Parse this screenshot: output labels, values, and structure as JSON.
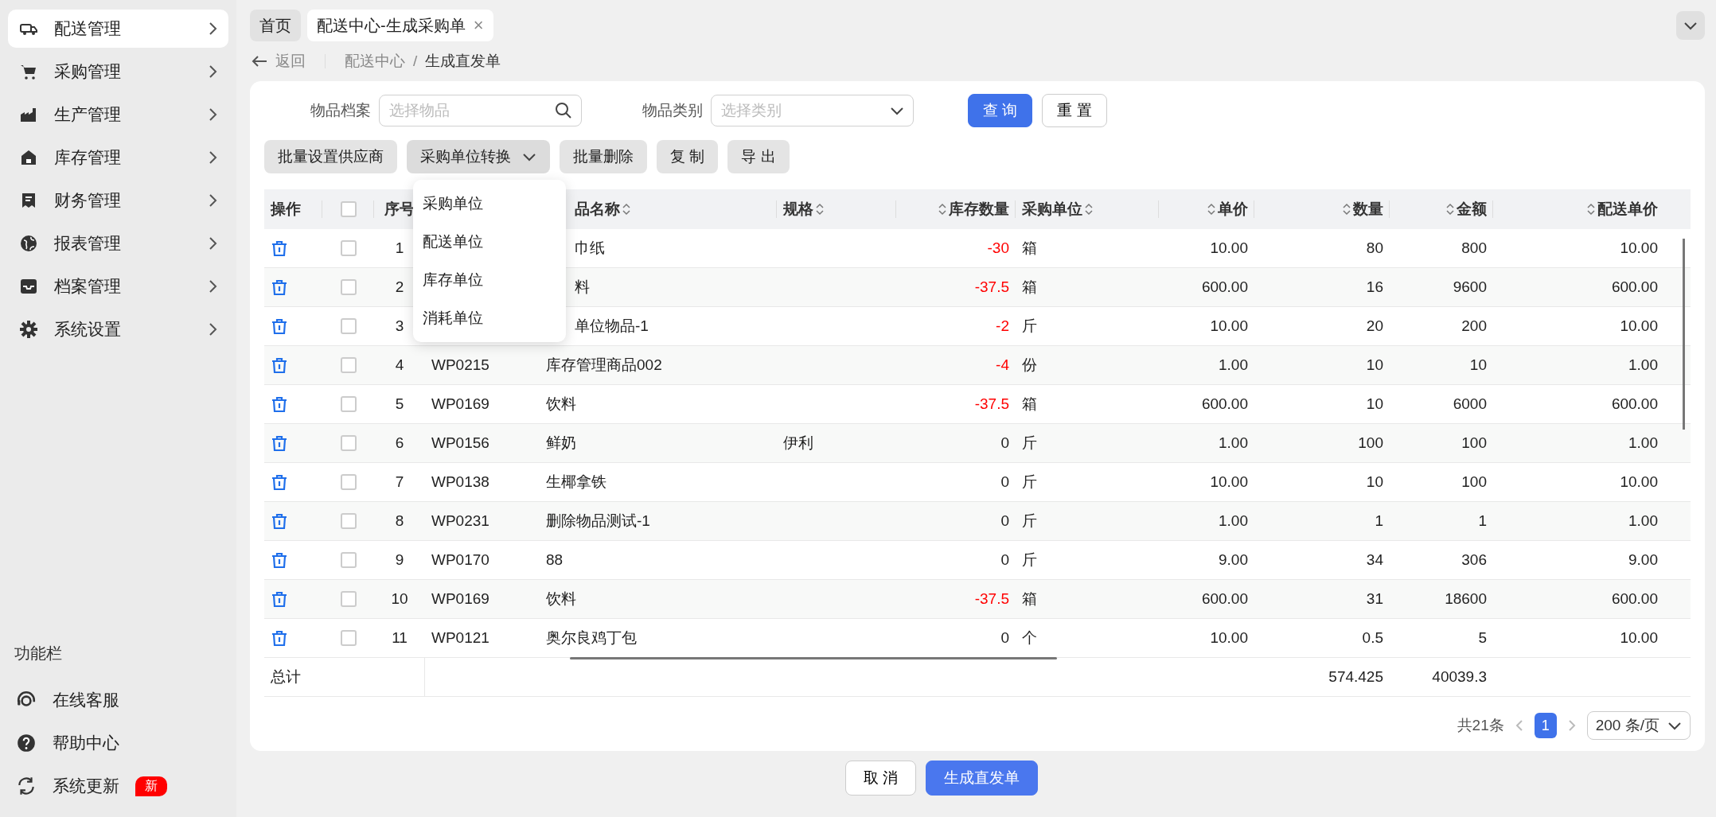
{
  "sidebar": {
    "items": [
      {
        "label": "配送管理",
        "selected": true
      },
      {
        "label": "采购管理",
        "selected": false
      },
      {
        "label": "生产管理",
        "selected": false
      },
      {
        "label": "库存管理",
        "selected": false
      },
      {
        "label": "财务管理",
        "selected": false
      },
      {
        "label": "报表管理",
        "selected": false
      },
      {
        "label": "档案管理",
        "selected": false
      },
      {
        "label": "系统设置",
        "selected": false
      }
    ],
    "footer_title": "功能栏",
    "footer_items": [
      {
        "label": "在线客服"
      },
      {
        "label": "帮助中心"
      },
      {
        "label": "系统更新",
        "badge": "新"
      }
    ]
  },
  "tabs": [
    {
      "label": "首页",
      "selected": false,
      "closable": false
    },
    {
      "label": "配送中心-生成采购单",
      "selected": true,
      "closable": true
    }
  ],
  "tab_close": "×",
  "back": "返回",
  "breadcrumb": [
    {
      "label": "配送中心",
      "current": false
    },
    {
      "label": "生成直发单",
      "current": true
    }
  ],
  "breadcrumb_separator": "/",
  "filters": [
    {
      "label": "物品档案",
      "placeholder": "选择物品",
      "kind": "search"
    },
    {
      "label": "物品类别",
      "placeholder": "选择类别",
      "kind": "select"
    }
  ],
  "filter_buttons": [
    {
      "label": "查 询",
      "primary": true
    },
    {
      "label": "重 置",
      "primary": false
    }
  ],
  "toolbar": [
    {
      "label": "批量设置供应商",
      "kind": "button"
    },
    {
      "label": "采购单位转换",
      "kind": "dropdown",
      "expanded": true,
      "options": [
        "采购单位",
        "配送单位",
        "库存单位",
        "消耗单位"
      ]
    },
    {
      "label": "批量删除",
      "kind": "button"
    },
    {
      "label": "复 制",
      "kind": "button"
    },
    {
      "label": "导 出",
      "kind": "button"
    }
  ],
  "table": {
    "columns": [
      {
        "label": "操作",
        "sortable": false
      },
      {
        "kind": "checkbox",
        "checked": false
      },
      {
        "label": "序号",
        "sortable": false
      },
      null,
      {
        "label": "品名称",
        "sortable": true
      },
      {
        "label": "规格",
        "sortable": true
      },
      {
        "label": "库存数量",
        "sortable": true
      },
      {
        "label": "采购单位",
        "sortable": true
      },
      {
        "label": "单价",
        "sortable": true
      },
      {
        "label": "数量",
        "sortable": true
      },
      {
        "label": "金额",
        "sortable": true
      },
      {
        "label": "配送单价",
        "sortable": true
      }
    ],
    "rows": [
      {
        "checked": false,
        "no": "1",
        "name": "巾纸",
        "stock": "-30",
        "stock_negative": true,
        "unit": "箱",
        "price": "10.00",
        "qty": "80",
        "amount": "800",
        "dist_price": "10.00"
      },
      {
        "checked": false,
        "no": "2",
        "name": "料",
        "stock": "-37.5",
        "stock_negative": true,
        "unit": "箱",
        "price": "600.00",
        "qty": "16",
        "amount": "9600",
        "dist_price": "600.00"
      },
      {
        "checked": false,
        "no": "3",
        "name": "单位物品-1",
        "stock": "-2",
        "stock_negative": true,
        "unit": "斤",
        "price": "10.00",
        "qty": "20",
        "amount": "200",
        "dist_price": "10.00"
      },
      {
        "checked": false,
        "no": "4",
        "code": "WP0215",
        "name": "库存管理商品002",
        "stock": "-4",
        "stock_negative": true,
        "unit": "份",
        "price": "1.00",
        "qty": "10",
        "amount": "10",
        "dist_price": "1.00"
      },
      {
        "checked": false,
        "no": "5",
        "code": "WP0169",
        "name": "饮料",
        "stock": "-37.5",
        "stock_negative": true,
        "unit": "箱",
        "price": "600.00",
        "qty": "10",
        "amount": "6000",
        "dist_price": "600.00"
      },
      {
        "checked": false,
        "no": "6",
        "code": "WP0156",
        "name": "鲜奶",
        "spec": "伊利",
        "stock": "0",
        "stock_negative": false,
        "unit": "斤",
        "price": "1.00",
        "qty": "100",
        "amount": "100",
        "dist_price": "1.00"
      },
      {
        "checked": false,
        "no": "7",
        "code": "WP0138",
        "name": "生椰拿铁",
        "stock": "0",
        "stock_negative": false,
        "unit": "斤",
        "price": "10.00",
        "qty": "10",
        "amount": "100",
        "dist_price": "10.00"
      },
      {
        "checked": false,
        "no": "8",
        "code": "WP0231",
        "name": "删除物品测试-1",
        "stock": "0",
        "stock_negative": false,
        "unit": "斤",
        "price": "1.00",
        "qty": "1",
        "amount": "1",
        "dist_price": "1.00"
      },
      {
        "checked": false,
        "no": "9",
        "code": "WP0170",
        "name": "88",
        "stock": "0",
        "stock_negative": false,
        "unit": "斤",
        "price": "9.00",
        "qty": "34",
        "amount": "306",
        "dist_price": "9.00"
      },
      {
        "checked": false,
        "no": "10",
        "code": "WP0169",
        "name": "饮料",
        "stock": "-37.5",
        "stock_negative": true,
        "unit": "箱",
        "price": "600.00",
        "qty": "31",
        "amount": "18600",
        "dist_price": "600.00"
      },
      {
        "checked": false,
        "no": "11",
        "code": "WP0121",
        "name": "奥尔良鸡丁包",
        "stock": "0",
        "stock_negative": false,
        "unit": "个",
        "price": "10.00",
        "qty": "0.5",
        "amount": "5",
        "dist_price": "10.00"
      }
    ],
    "total": {
      "label": "总计",
      "qty": "574.425",
      "amount": "40039.3"
    }
  },
  "pagination": {
    "total": "共21条",
    "pages": [
      {
        "label": "1",
        "selected": true
      }
    ],
    "page_size": "200 条/页"
  },
  "footer_buttons": [
    {
      "label": "取 消",
      "primary": false
    },
    {
      "label": "生成直发单",
      "primary": true
    }
  ]
}
